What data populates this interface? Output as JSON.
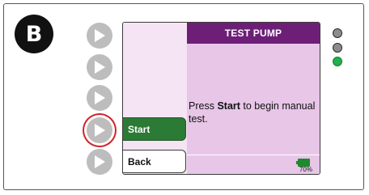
{
  "step": {
    "label": "B"
  },
  "screen": {
    "title": "TEST PUMP",
    "message_pre": "Press ",
    "message_bold": "Start",
    "message_post": " to begin manual test.",
    "softkeys": {
      "start": "Start",
      "back": "Back"
    },
    "battery": {
      "level_percent": 70,
      "label": "70%",
      "color": "#1e8a2e"
    }
  },
  "hardware_buttons": [
    {
      "icon": "play-triangle-icon",
      "highlighted": false
    },
    {
      "icon": "play-triangle-icon",
      "highlighted": false
    },
    {
      "icon": "play-triangle-icon",
      "highlighted": false
    },
    {
      "icon": "play-triangle-icon",
      "highlighted": true,
      "highlight_color": "#d2232a"
    },
    {
      "icon": "play-triangle-icon",
      "highlighted": false
    }
  ],
  "indicator_leds": [
    {
      "state": "off",
      "color": "#8c8c8c"
    },
    {
      "state": "off",
      "color": "#8c8c8c"
    },
    {
      "state": "on",
      "color": "#21b04b"
    }
  ],
  "colors": {
    "title_bar": "#6d1f78",
    "screen_bg": "#e7c6e8",
    "start_key": "#2b7a35"
  }
}
